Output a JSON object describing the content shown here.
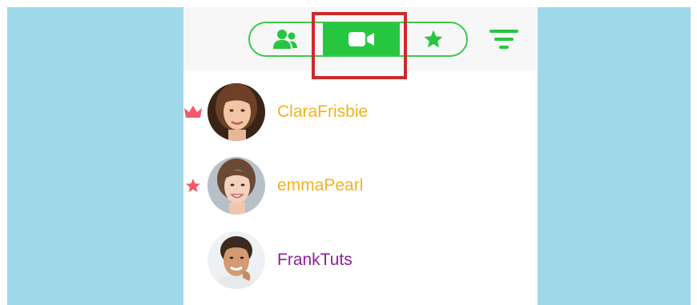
{
  "segments": [
    {
      "id": "contacts",
      "icon": "contacts-icon",
      "selected": false
    },
    {
      "id": "video",
      "icon": "video-camera-icon",
      "selected": true
    },
    {
      "id": "favorites",
      "icon": "star-icon",
      "selected": false
    }
  ],
  "colors": {
    "accent_green": "#26c641",
    "side_background": "#9fd8e9",
    "highlight_red": "#cc2a2c",
    "badge_red": "#ef5b6b",
    "name_gold": "#f2b21c",
    "name_purple": "#8a2296"
  },
  "contacts": [
    {
      "name": "ClaraFrisbie",
      "badge": "crown-icon",
      "name_color": "gold"
    },
    {
      "name": "emmaPearl",
      "badge": "star-icon",
      "name_color": "gold"
    },
    {
      "name": "FrankTuts",
      "badge": "",
      "name_color": "purple"
    }
  ]
}
